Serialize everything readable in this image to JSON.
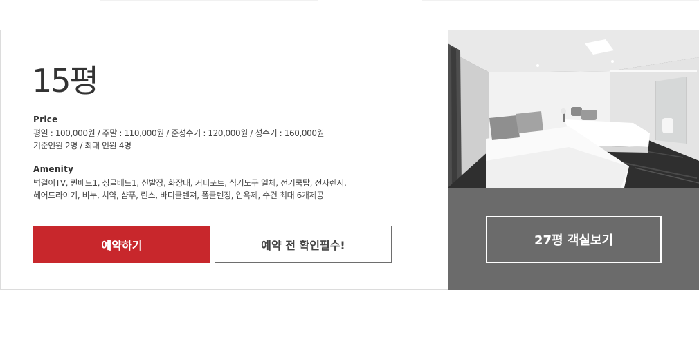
{
  "room": {
    "title": "15평",
    "price": {
      "heading": "Price",
      "line1": "평일 : 100,000원 / 주말 : 110,000원 / 준성수기 : 120,000원 / 성수기 : 160,000원",
      "line2": "기준인원 2명 / 최대 인원 4명"
    },
    "amenity": {
      "heading": "Amenity",
      "line1": "벽걸이TV, 퀸베드1, 싱글베드1, 신발장, 화장대, 커피포트, 식기도구 일체, 전기쿡탑, 전자렌지,",
      "line2": "헤어드라이기, 비누, 치약, 샴푸, 린스, 바디클렌져, 폼클렌징, 입욕제, 수건 최대 6개제공"
    }
  },
  "buttons": {
    "reserve": "예약하기",
    "check": "예약 전 확인필수!",
    "other_room": "27평 객실보기"
  },
  "colors": {
    "accent": "#c8272c",
    "image_panel_bg": "#6b6b6b"
  }
}
